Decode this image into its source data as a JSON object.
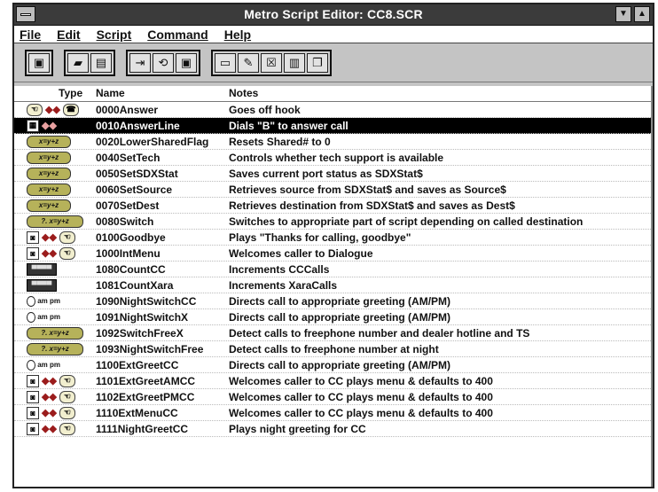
{
  "window": {
    "title": "Metro Script Editor: CC8.SCR"
  },
  "menu": [
    "File",
    "Edit",
    "Script",
    "Command",
    "Help"
  ],
  "toolbar": {
    "group1": [
      "save-icon"
    ],
    "group2": [
      "open-icon",
      "disk-icon"
    ],
    "group3": [
      "insert-icon",
      "link-icon",
      "disk-icon"
    ],
    "group4": [
      "folder-icon",
      "edit-icon",
      "pointer-icon",
      "copy-icon",
      "stack-icon"
    ]
  },
  "columns": {
    "type": "Type",
    "name": "Name",
    "notes": "Notes"
  },
  "rows": [
    {
      "name": "0000Answer",
      "notes": "Goes off hook",
      "icon": "hook-hand",
      "selected": false
    },
    {
      "name": "0010AnswerLine",
      "notes": "Dials \"B\" to answer call",
      "icon": "dial",
      "selected": true
    },
    {
      "name": "0020LowerSharedFlag",
      "notes": "Resets Shared# to 0",
      "icon": "formula",
      "selected": false
    },
    {
      "name": "0040SetTech",
      "notes": "Controls whether tech support is available",
      "icon": "formula",
      "selected": false
    },
    {
      "name": "0050SetSDXStat",
      "notes": "Saves current port status as SDXStat$",
      "icon": "formula",
      "selected": false
    },
    {
      "name": "0060SetSource",
      "notes": "Retrieves source from SDXStat$ and saves as Source$",
      "icon": "formula",
      "selected": false
    },
    {
      "name": "0070SetDest",
      "notes": "Retrieves destination from SDXStat$ and saves as Dest$",
      "icon": "formula",
      "selected": false
    },
    {
      "name": "0080Switch",
      "notes": "Switches to appropriate part of script depending on called destination",
      "icon": "formula-switch",
      "selected": false
    },
    {
      "name": "0100Goodbye",
      "notes": "Plays \"Thanks for calling, goodbye\"",
      "icon": "play-hand",
      "selected": false
    },
    {
      "name": "1000IntMenu",
      "notes": "Welcomes caller to Dialogue",
      "icon": "play-hand",
      "selected": false
    },
    {
      "name": "1080CountCC",
      "notes": "Increments CCCalls",
      "icon": "counter",
      "selected": false
    },
    {
      "name": "1081CountXara",
      "notes": "Increments XaraCalls",
      "icon": "counter",
      "selected": false
    },
    {
      "name": "1090NightSwitchCC",
      "notes": "Directs call to appropriate greeting (AM/PM)",
      "icon": "clock",
      "selected": false
    },
    {
      "name": "1091NightSwitchX",
      "notes": "Directs call to appropriate greeting (AM/PM)",
      "icon": "clock",
      "selected": false
    },
    {
      "name": "1092SwitchFreeX",
      "notes": "Detect calls to freephone number and dealer hotline and TS",
      "icon": "formula-switch",
      "selected": false
    },
    {
      "name": "1093NightSwitchFree",
      "notes": "Detect calls to freephone number at night",
      "icon": "formula-switch",
      "selected": false
    },
    {
      "name": "1100ExtGreetCC",
      "notes": "Directs call to appropriate greeting (AM/PM)",
      "icon": "clock",
      "selected": false
    },
    {
      "name": "1101ExtGreetAMCC",
      "notes": "Welcomes caller to CC plays menu & defaults to 400",
      "icon": "play-hand",
      "selected": false
    },
    {
      "name": "1102ExtGreetPMCC",
      "notes": "Welcomes caller to CC plays menu & defaults to 400",
      "icon": "play-hand",
      "selected": false
    },
    {
      "name": "1110ExtMenuCC",
      "notes": "Welcomes caller to CC plays menu & defaults to 400",
      "icon": "play-hand",
      "selected": false
    },
    {
      "name": "1111NightGreetCC",
      "notes": "Plays night greeting for CC",
      "icon": "play-hand",
      "selected": false
    }
  ],
  "glyphs": {
    "formula": "x=y+z",
    "formula_switch": "?. x=y+z",
    "clock_label": "am pm",
    "counter": "▀▀▀▀"
  }
}
